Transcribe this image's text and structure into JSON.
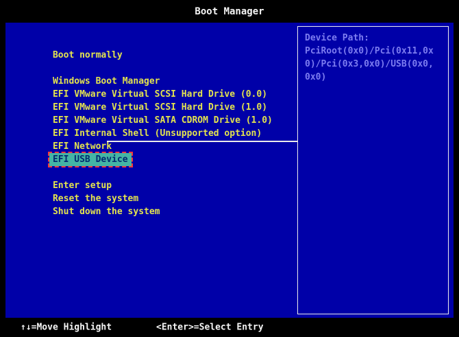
{
  "window": {
    "title": "Boot Manager"
  },
  "menu": {
    "items": [
      {
        "label": "Boot normally",
        "selected": false
      },
      {
        "label": "Windows Boot Manager",
        "selected": false
      },
      {
        "label": "EFI VMware Virtual SCSI Hard Drive (0.0)",
        "selected": false
      },
      {
        "label": "EFI VMware Virtual SCSI Hard Drive (1.0)",
        "selected": false
      },
      {
        "label": "EFI VMware Virtual SATA CDROM Drive (1.0)",
        "selected": false
      },
      {
        "label": "EFI Internal Shell (Unsupported option)",
        "selected": false
      },
      {
        "label": "EFI Network",
        "selected": false
      },
      {
        "label": "EFI USB Device",
        "selected": true
      },
      {
        "label": "Enter setup",
        "selected": false
      },
      {
        "label": "Reset the system",
        "selected": false
      },
      {
        "label": "Shut down the system",
        "selected": false
      }
    ]
  },
  "device_path_panel": {
    "title": "Device Path:",
    "path": "PciRoot(0x0)/Pci(0x11,0x0)/Pci(0x3,0x0)/USB(0x0,0x0)"
  },
  "footer": {
    "move_hint": "↑↓=Move Highlight",
    "select_hint": "<Enter>=Select Entry"
  },
  "colors": {
    "screen_blue": "#0000a8",
    "menu_text": "#e4e44e",
    "panel_text": "#7d7df0",
    "panel_border": "#ededed",
    "highlight_bg": "#44b5a5",
    "highlight_text": "#002a70",
    "highlight_outline": "#f23b3b",
    "bar_text": "#f5f5f5"
  }
}
